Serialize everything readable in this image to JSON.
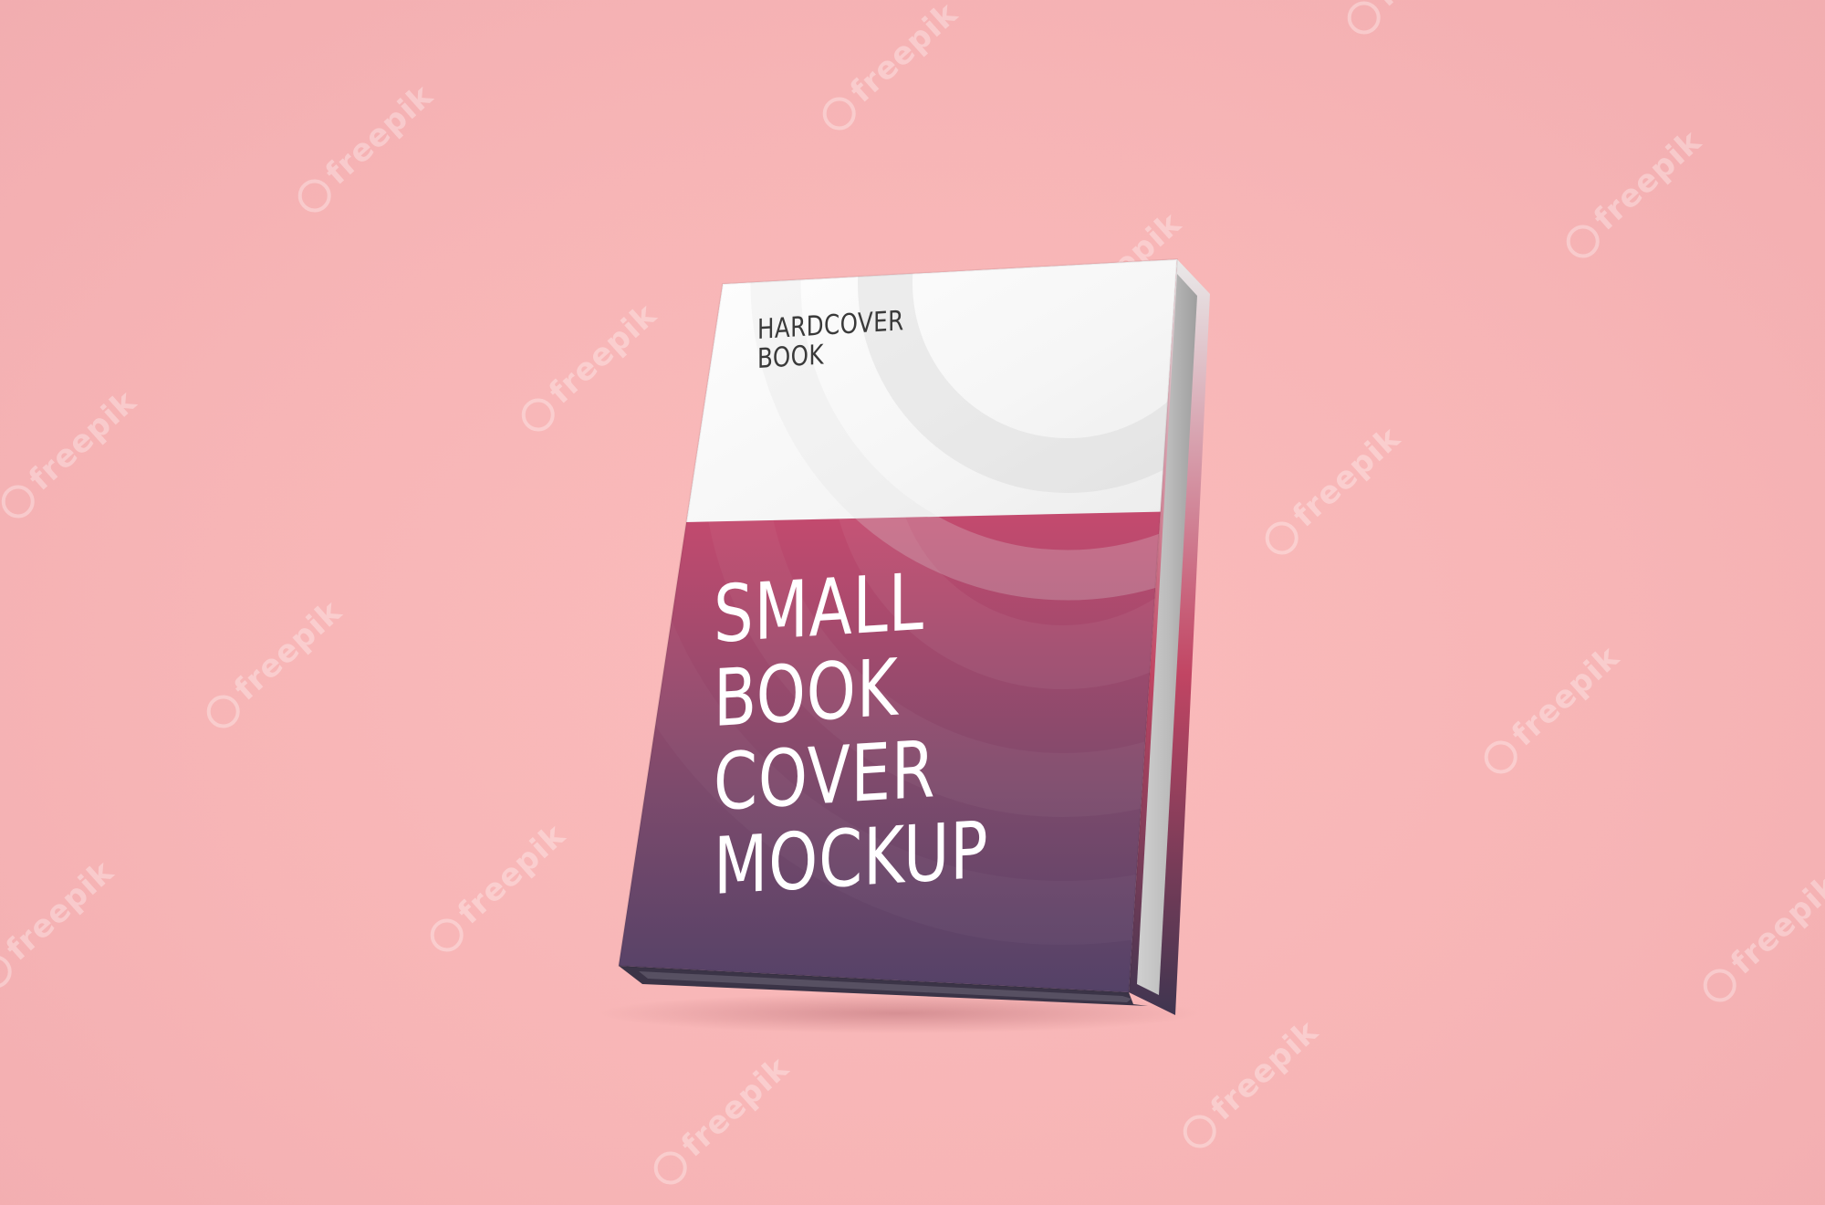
{
  "cover": {
    "label_line1": "HARDCOVER",
    "label_line2": "BOOK",
    "title_lines": [
      "SMALL",
      "BOOK",
      "COVER",
      "MOCKUP"
    ]
  },
  "watermark": {
    "text": "freepik"
  },
  "colors": {
    "background": "#f7b5b6",
    "cover_top": "#ffffff",
    "cover_pink": "#dc4f72",
    "cover_purple": "#4e4166",
    "spine_edge": "#d8d8d8"
  }
}
